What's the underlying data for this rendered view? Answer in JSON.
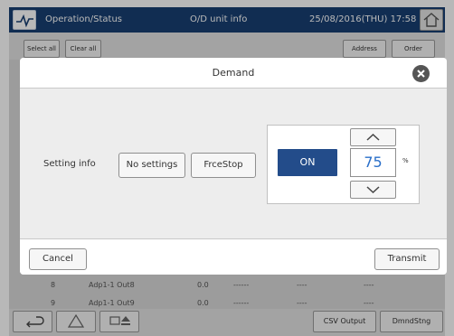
{
  "header": {
    "title": "Operation/Status",
    "subtitle": "O/D unit info",
    "datetime": "25/08/2016(THU) 17:58"
  },
  "toolbar": {
    "select_all": "Select all",
    "clear_all": "Clear all",
    "address": "Address",
    "order": "Order"
  },
  "background_rows": [
    {
      "no": "8",
      "name": "Adp1-1 Out8",
      "value": "0.0",
      "dash1": "------",
      "dash2": "----",
      "dash3": "----"
    },
    {
      "no": "9",
      "name": "Adp1-1 Out9",
      "value": "0.0",
      "dash1": "------",
      "dash2": "----",
      "dash3": "----"
    }
  ],
  "bottom_bar": {
    "csv_output": "CSV Output",
    "dmnd_stng": "DmndStng"
  },
  "dialog": {
    "title": "Demand",
    "setting_label": "Setting info",
    "options": [
      "No settings",
      "FrceStop"
    ],
    "on_label": "ON",
    "value": "75",
    "unit": "%",
    "cancel": "Cancel",
    "transmit": "Transmit"
  },
  "colors": {
    "header_bg": "#183f72",
    "on_button": "#234c8a",
    "value_text": "#2a6fc9"
  },
  "icons": {
    "status": "status-monitor-icon",
    "home": "home-icon",
    "close": "close-icon",
    "back": "return-arrow-icon",
    "warning": "warning-triangle-icon",
    "eject": "eject-icon",
    "up": "chevron-up-icon",
    "down": "chevron-down-icon"
  }
}
